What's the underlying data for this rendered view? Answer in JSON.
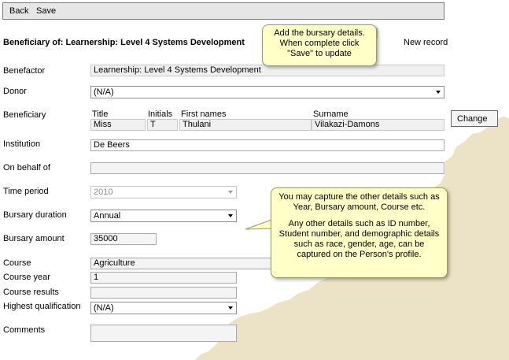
{
  "toolbar": {
    "back_label": "Back",
    "save_label": "Save"
  },
  "heading": "Beneficiary of: Learnership: Level 4 Systems Development",
  "new_record": "New record",
  "labels": {
    "benefactor": "Benefactor",
    "donor": "Donor",
    "beneficiary": "Beneficiary",
    "institution": "Institution",
    "on_behalf_of": "On behalf of",
    "time_period": "Time period",
    "bursary_duration": "Bursary duration",
    "bursary_amount": "Bursary amount",
    "course": "Course",
    "course_year": "Course year",
    "course_results": "Course results",
    "highest_qualification": "Highest qualification",
    "comments": "Comments"
  },
  "beneficiary_cols": {
    "title": "Title",
    "initials": "Initials",
    "first_names": "First names",
    "surname": "Surname"
  },
  "values": {
    "benefactor": "Learnership: Level 4 Systems Development",
    "donor": "(N/A)",
    "title": "Miss",
    "initials": "T",
    "first_names": "Thulani",
    "surname": "Vilakazi-Damons",
    "institution": "De Beers",
    "on_behalf_of": "",
    "time_period": "2010",
    "bursary_duration": "Annual",
    "bursary_amount": "35000",
    "course": "Agriculture",
    "course_year": "1",
    "course_results": "",
    "highest_qualification": "(N/A)",
    "comments": ""
  },
  "change_button": "Change",
  "callout_top": [
    "Add the bursary details.",
    "When complete click",
    "\"Save\" to update"
  ],
  "callout_mid": {
    "para1": [
      "You may capture the other details such as",
      "Year, Bursary amount, Course etc."
    ],
    "para2": [
      "Any other details such as ID number,",
      "Student number, and demographic details",
      "such as race, gender, age, can be",
      "captured on the Person's profile."
    ]
  },
  "colors": {
    "callout_bg": "#ffffc8",
    "page_bg": "#ece3c7",
    "toolbar_bg": "#e6e6e6"
  }
}
